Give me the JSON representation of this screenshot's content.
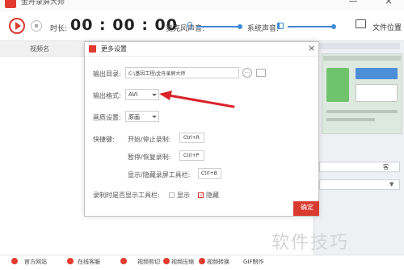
{
  "app": {
    "title": "金舟录屏大师"
  },
  "toolbar": {
    "duration_label": "时长:",
    "timer": "00 : 00 : 00",
    "mic_label": "麦克风声音:",
    "system_label": "系统声音:",
    "folder_label": "文件位置"
  },
  "left_panel": {
    "column_video_name": "视频名"
  },
  "right_panel": {
    "field_value": "客"
  },
  "dialog": {
    "title": "更多设置",
    "output_dir_label": "输出目录:",
    "output_dir_value": "C:\\基因工程\\金舟录屏大师",
    "output_format_label": "输出格式:",
    "output_format_value": "AVI",
    "quality_label": "画质设置:",
    "quality_value": "原画",
    "hotkey_label": "快捷键:",
    "hotkeys": [
      {
        "label": "开始/停止录制:",
        "key": "Ctrl+R"
      },
      {
        "label": "暂停/恢复录制:",
        "key": "Ctrl+P"
      },
      {
        "label": "显示/隐藏录屏工具栏:",
        "key": "Ctrl+B"
      }
    ],
    "toolbar_visibility_label": "录制时是否显示工具栏:",
    "option_show": "显示",
    "option_hide": "隐藏",
    "option_hide_checked": true,
    "confirm_partial": "确定"
  },
  "bottom_bar": {
    "items": [
      "官方网站",
      "在线客服",
      "视频剪切",
      "视频压缩",
      "视频转换",
      "GIF制作"
    ]
  },
  "annotation": {
    "arrow_color": "#d9242a"
  },
  "watermark": "软件技巧",
  "colors": {
    "brand_red": "#e33b2f",
    "accent_blue": "#3f8ad6"
  }
}
